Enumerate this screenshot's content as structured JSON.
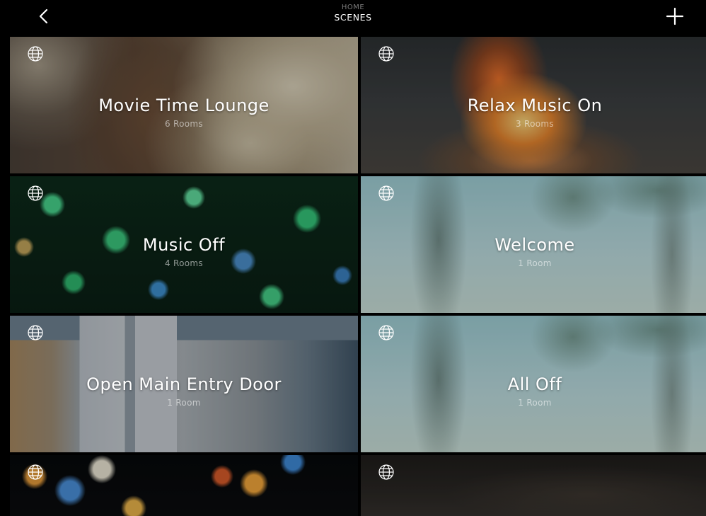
{
  "header": {
    "breadcrumb": "HOME",
    "title": "SCENES",
    "back_icon": "chevron-left-icon",
    "add_icon": "plus-icon"
  },
  "scenes": [
    {
      "name": "Movie Time Lounge",
      "rooms": "6 Rooms",
      "icon": "globe-icon"
    },
    {
      "name": "Relax Music On",
      "rooms": "3 Rooms",
      "icon": "globe-icon"
    },
    {
      "name": "Music Off",
      "rooms": "4 Rooms",
      "icon": "globe-icon"
    },
    {
      "name": "Welcome",
      "rooms": "1 Room",
      "icon": "globe-icon"
    },
    {
      "name": "Open Main Entry Door",
      "rooms": "1 Room",
      "icon": "globe-icon"
    },
    {
      "name": "All Off",
      "rooms": "1 Room",
      "icon": "globe-icon"
    },
    {
      "name": "",
      "rooms": "",
      "icon": "globe-icon"
    },
    {
      "name": "",
      "rooms": "",
      "icon": "globe-icon"
    }
  ],
  "colors": {
    "background": "#000000",
    "breadcrumb": "#7d7d7d",
    "text": "#ffffff"
  }
}
